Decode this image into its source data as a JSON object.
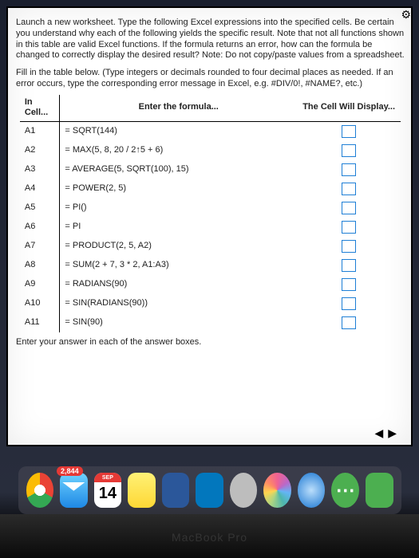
{
  "gear_label": "⚙",
  "instructions_text": "Launch a new worksheet. Type the following Excel expressions into the specified cells. Be certain you understand why each of the following yields the specific result. Note that not all functions shown in this table are valid Excel functions. If the formula returns an error, how can the formula be changed to correctly display the desired result?   Note:  Do not copy/paste values from a spreadsheet.",
  "fillin_text": "Fill in the table below. (Type integers or decimals rounded to four decimal places as needed. If an error occurs, type the corresponding error message in Excel, e.g. #DIV/0!, #NAME?, etc.)",
  "headers": {
    "c1": "In Cell...",
    "c2": "Enter the formula...",
    "c3": "The Cell Will Display..."
  },
  "rows": [
    {
      "cell": "A1",
      "formula": "= SQRT(144)"
    },
    {
      "cell": "A2",
      "formula": "= MAX(5, 8, 20 / 2↑5 + 6)"
    },
    {
      "cell": "A3",
      "formula": "= AVERAGE(5, SQRT(100), 15)"
    },
    {
      "cell": "A4",
      "formula": "= POWER(2, 5)"
    },
    {
      "cell": "A5",
      "formula": "= PI()"
    },
    {
      "cell": "A6",
      "formula": "= PI"
    },
    {
      "cell": "A7",
      "formula": "= PRODUCT(2, 5, A2)"
    },
    {
      "cell": "A8",
      "formula": "= SUM(2 + 7, 3 * 2, A1:A3)"
    },
    {
      "cell": "A9",
      "formula": "= RADIANS(90)"
    },
    {
      "cell": "A10",
      "formula": "= SIN(RADIANS(90))"
    },
    {
      "cell": "A11",
      "formula": "= SIN(90)"
    }
  ],
  "bottom_note": "Enter your answer in each of the answer boxes.",
  "nav": {
    "prev": "◀",
    "next": "▶"
  },
  "dock": {
    "mail_badge": "2,844",
    "cal_month": "SEP",
    "cal_day": "14"
  },
  "laptop_text": "MacBook Pro"
}
